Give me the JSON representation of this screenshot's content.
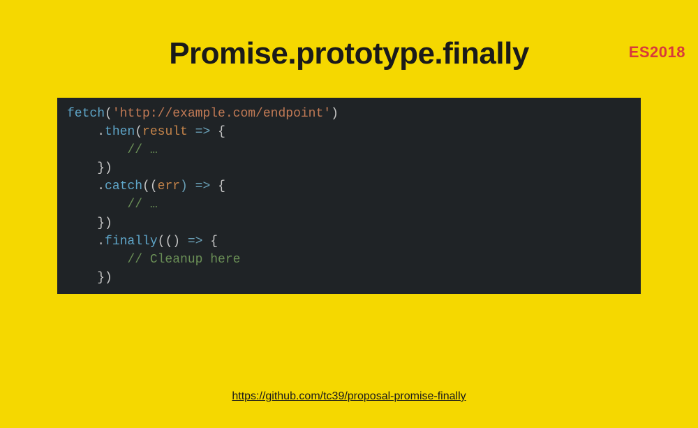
{
  "badge": "ES2018",
  "title": "Promise.prototype.finally",
  "code": {
    "line1_fn": "fetch",
    "line1_paren_open": "(",
    "line1_str": "'http://example.com/endpoint'",
    "line1_paren_close": ")",
    "line2_indent": "    .",
    "line2_method": "then",
    "line2_open": "(",
    "line2_param": "result",
    "line2_arrow": " => ",
    "line2_brace": "{",
    "line3_indent": "        ",
    "line3_comment": "// …",
    "line4_indent": "    ",
    "line4_close": "})",
    "line5_indent": "    .",
    "line5_method": "catch",
    "line5_open": "((",
    "line5_param": "err",
    "line5_close_arrow": ") => ",
    "line5_brace": "{",
    "line6_indent": "        ",
    "line6_comment": "// …",
    "line7_indent": "    ",
    "line7_close": "})",
    "line8_indent": "    .",
    "line8_method": "finally",
    "line8_open": "(() ",
    "line8_arrow": "=> ",
    "line8_brace": "{",
    "line9_indent": "        ",
    "line9_comment": "// Cleanup here",
    "line10_indent": "    ",
    "line10_close": "})"
  },
  "footer_url": "https://github.com/tc39/proposal-promise-finally"
}
